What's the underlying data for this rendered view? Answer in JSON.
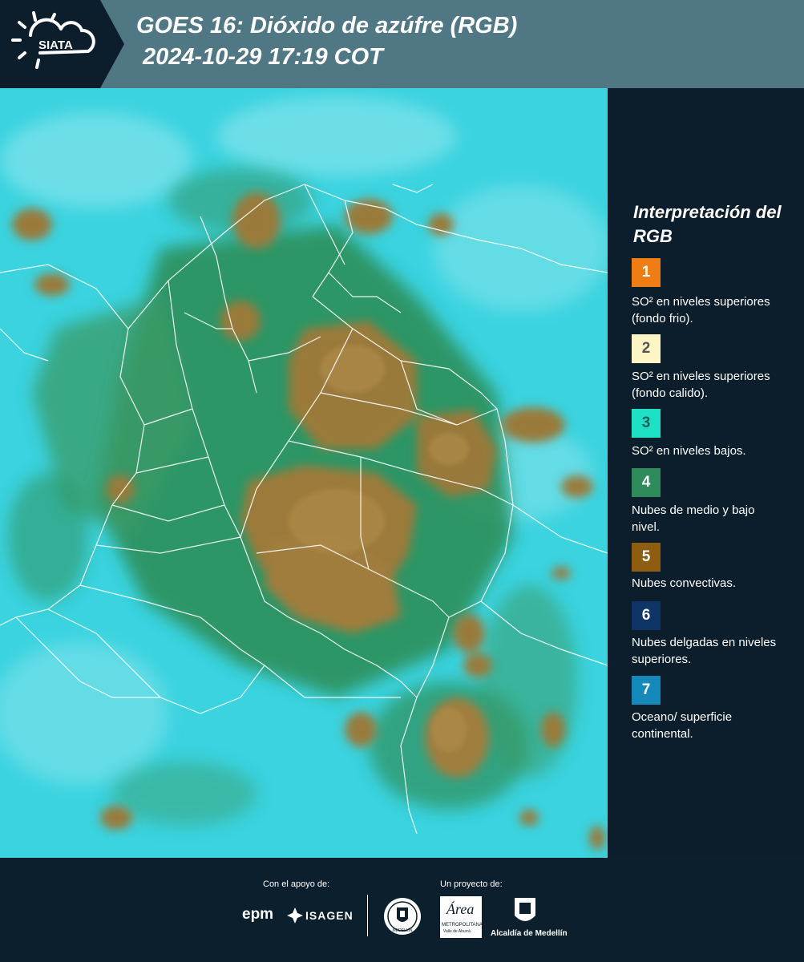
{
  "header": {
    "logo_text": "SIATA",
    "title_line1": "GOES 16: Dióxido de azúfre (RGB)",
    "title_line2": "2024-10-29 17:19 COT"
  },
  "legend": {
    "title": "Interpretación del RGB",
    "items": [
      {
        "number": "1",
        "color": "#f07d13",
        "text_color": "#ffffff",
        "description": "SO² en niveles superiores (fondo frio)."
      },
      {
        "number": "2",
        "color": "#fdf5c4",
        "text_color": "#555555",
        "description": "SO² en niveles superiores (fondo calido)."
      },
      {
        "number": "3",
        "color": "#1ee0c4",
        "text_color": "#1f5f5a",
        "description": "SO² en niveles bajos."
      },
      {
        "number": "4",
        "color": "#2f8a5c",
        "text_color": "#ffffff",
        "description": "Nubes de medio y bajo nivel."
      },
      {
        "number": "5",
        "color": "#8e5d0f",
        "text_color": "#ffffff",
        "description": "Nubes convectivas."
      },
      {
        "number": "6",
        "color": "#0d3566",
        "text_color": "#ffffff",
        "description": "Nubes delgadas en niveles superiores."
      },
      {
        "number": "7",
        "color": "#1689bb",
        "text_color": "#ffffff",
        "description": "Oceano/ superficie continental."
      }
    ]
  },
  "footer": {
    "support_label": "Con el apoyo de:",
    "project_label": "Un proyecto de:",
    "epm_logo": "epm",
    "isagen_logo": "ISAGEN",
    "area_logo": "Área",
    "area_logo_sub1": "METROPOLITANA",
    "area_logo_sub2": "Valle de Aburrá",
    "alcaldia_logo": "Alcaldía de Medellín",
    "medellin_seal": "MEDELLÍN"
  },
  "map": {
    "colors": {
      "background": "#39d4e0",
      "vegetation": "#3a9a5e",
      "convective": "#9a7a3c",
      "borders": "#ffffff"
    }
  }
}
